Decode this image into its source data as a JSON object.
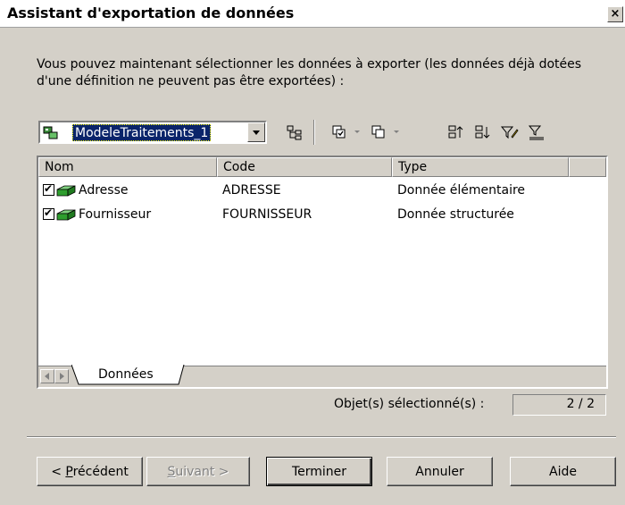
{
  "window": {
    "title": "Assistant d'exportation de données",
    "close_label": "×"
  },
  "intro_text": "Vous pouvez maintenant sélectionner les données à exporter (les données déjà dotées d'une définition ne peuvent pas être exportées) :",
  "toolbar": {
    "model_selected": "ModeleTraitements_1"
  },
  "list": {
    "columns": [
      "Nom",
      "Code",
      "Type"
    ],
    "rows": [
      {
        "checked": true,
        "name": "Adresse",
        "code": "ADRESSE",
        "type": "Donnée élémentaire"
      },
      {
        "checked": true,
        "name": "Fournisseur",
        "code": "FOURNISSEUR",
        "type": "Donnée structurée"
      }
    ],
    "tab_label": "Données"
  },
  "selection": {
    "label": "Objet(s) sélectionné(s) :",
    "count": "2 / 2"
  },
  "buttons": {
    "previous_prefix": "< ",
    "previous_accel": "P",
    "previous_rest": "récédent",
    "next_accel": "S",
    "next_rest": "uivant >",
    "finish": "Terminer",
    "cancel": "Annuler",
    "help": "Aide"
  },
  "colors": {
    "dialog_bg": "#d4d0c8",
    "selection_bg": "#0a246a",
    "icon_green": "#2e9e2e"
  }
}
